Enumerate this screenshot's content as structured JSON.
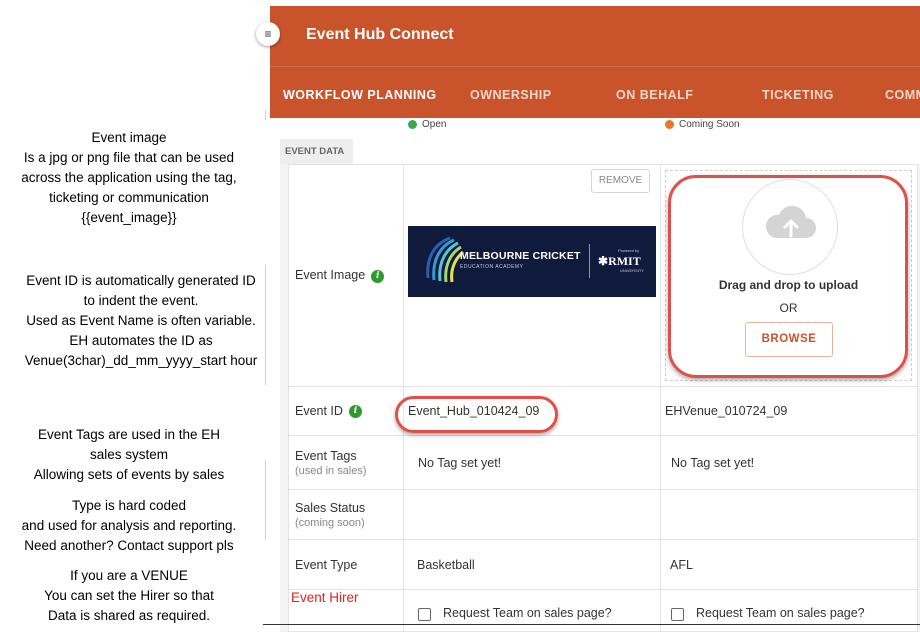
{
  "annotations": [
    {
      "lines": [
        "Event image",
        "Is a jpg or png file that can be used",
        "across the application using the tag,",
        "ticketing or communication",
        "{{event_image}}"
      ]
    },
    {
      "lines": [
        "Event ID is automatically  generated ID",
        "to indent the event.",
        "Used as Event Name is often variable.",
        "EH automates the ID as",
        "Venue(3char)_dd_mm_yyyy_start hour"
      ]
    },
    {
      "lines": [
        "Event Tags are used in the EH",
        "sales system",
        "Allowing sets of events by sales"
      ]
    },
    {
      "lines": [
        "Type is hard coded",
        "and used for analysis and reporting.",
        "Need another? Contact support pls"
      ]
    },
    {
      "lines": [
        "If you are a VENUE",
        "You can set the Hirer so that",
        "Data is shared as required."
      ]
    }
  ],
  "app": {
    "title": "Event Hub Connect",
    "tabs": [
      "WORKFLOW PLANNING",
      "OWNERSHIP",
      "ON BEHALF",
      "TICKETING",
      "COMM"
    ]
  },
  "statuses": [
    {
      "label": "Open",
      "color": "#3aa94a"
    },
    {
      "label": "Coming Soon",
      "color": "#e8782a"
    }
  ],
  "section_label": "EVENT DATA",
  "fields": {
    "event_image": {
      "label": "Event Image",
      "remove": "REMOVE",
      "drag": "Drag and drop to upload",
      "or": "OR",
      "browse": "BROWSE"
    },
    "logo": {
      "main": "MELBOURNE CRICKET",
      "sub": "EDUCATION ACADEMY",
      "powered_by": "Powered by",
      "rmit": "RMIT",
      "university": "UNIVERSITY"
    },
    "event_id": {
      "label": "Event ID",
      "values": [
        "Event_Hub_010424_09",
        "EHVenue_010724_09"
      ]
    },
    "event_tags": {
      "label": "Event Tags",
      "sub": "(used in sales)",
      "values": [
        "No Tag set yet!",
        "No Tag set yet!"
      ]
    },
    "sales_status": {
      "label": "Sales Status",
      "sub": "(coming soon)"
    },
    "event_type": {
      "label": "Event Type",
      "values": [
        "Basketball",
        "AFL"
      ]
    },
    "request_team": {
      "values": [
        "Request Team on sales page?",
        "Request Team on sales page?"
      ]
    }
  },
  "event_hirer": "Event Hirer",
  "colors": {
    "brand": "#c9532a",
    "highlight": "#e0504a",
    "info": "#2e9a2e",
    "warning_text": "#e24a3b"
  }
}
